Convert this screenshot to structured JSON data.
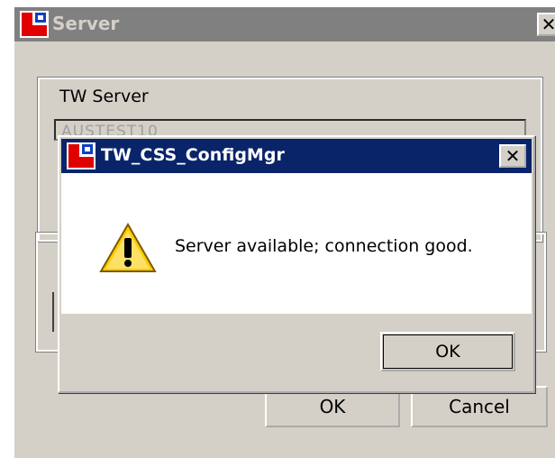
{
  "background_window": {
    "title": "Server",
    "close_glyph": "✕",
    "group_label": "TW Server",
    "server_field_value": "AUSTEST10",
    "ok_label": "OK",
    "cancel_label": "Cancel",
    "icon": "app-logo-icon"
  },
  "dialog": {
    "title": "TW_CSS_ConfigMgr",
    "close_glyph": "✕",
    "message": "Server available; connection good.",
    "ok_label": "OK",
    "icon": "warning-icon"
  },
  "colors": {
    "active_titlebar": "#0a246a",
    "inactive_titlebar": "#808080",
    "window_face": "#d4d0c8",
    "app_logo_red": "#e00000"
  }
}
